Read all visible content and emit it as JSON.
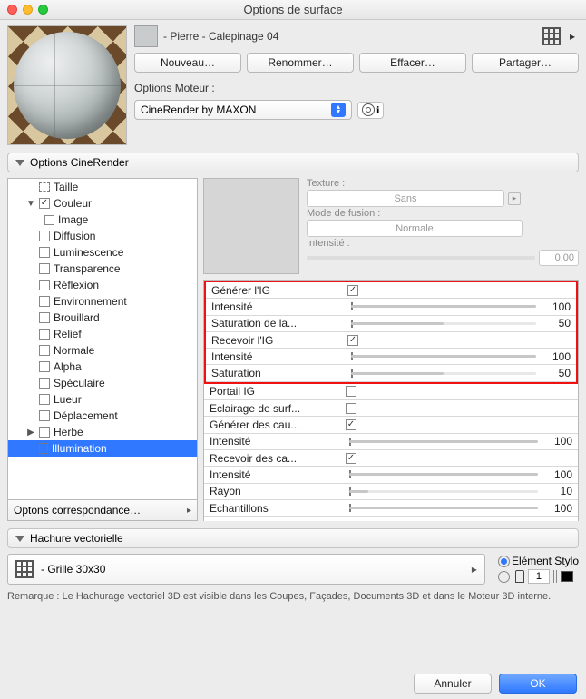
{
  "window": {
    "title": "Options de surface"
  },
  "material": {
    "name": "- Pierre - Calepinage 04"
  },
  "buttons": {
    "new": "Nouveau…",
    "rename": "Renommer…",
    "delete": "Effacer…",
    "share": "Partager…"
  },
  "engine": {
    "label": "Options Moteur :",
    "value": "CineRender by MAXON"
  },
  "cine_section": {
    "title": "Options CineRender"
  },
  "tree": {
    "items": [
      {
        "label": "Taille",
        "type": "size"
      },
      {
        "label": "Couleur",
        "type": "cb",
        "checked": true,
        "expand": true
      },
      {
        "label": "Image",
        "type": "img",
        "indent": 2
      },
      {
        "label": "Diffusion",
        "type": "cb"
      },
      {
        "label": "Luminescence",
        "type": "cb"
      },
      {
        "label": "Transparence",
        "type": "cb"
      },
      {
        "label": "Réflexion",
        "type": "cb"
      },
      {
        "label": "Environnement",
        "type": "cb"
      },
      {
        "label": "Brouillard",
        "type": "cb"
      },
      {
        "label": "Relief",
        "type": "cb"
      },
      {
        "label": "Normale",
        "type": "cb"
      },
      {
        "label": "Alpha",
        "type": "cb"
      },
      {
        "label": "Spéculaire",
        "type": "cb"
      },
      {
        "label": "Lueur",
        "type": "cb"
      },
      {
        "label": "Déplacement",
        "type": "cb"
      },
      {
        "label": "Herbe",
        "type": "cb",
        "expander": true
      },
      {
        "label": "Illumination",
        "type": "file",
        "selected": true
      }
    ],
    "footer": "Optons correspondance…"
  },
  "texture": {
    "label_tex": "Texture :",
    "btn_tex": "Sans",
    "label_mode": "Mode de fusion :",
    "btn_mode": "Normale",
    "label_int": "Intensité :",
    "val_int": "0,00"
  },
  "props": {
    "group_red": [
      {
        "name": "Générer l'IG",
        "type": "check",
        "checked": true
      },
      {
        "name": "Intensité",
        "type": "slider",
        "value": 100
      },
      {
        "name": "Saturation de la...",
        "type": "slider",
        "value": 50
      },
      {
        "name": "Recevoir l'IG",
        "type": "check",
        "checked": true
      },
      {
        "name": "Intensité",
        "type": "slider",
        "value": 100
      },
      {
        "name": "Saturation",
        "type": "slider",
        "value": 50
      }
    ],
    "rest": [
      {
        "name": "Portail IG",
        "type": "check",
        "checked": false
      },
      {
        "name": "Eclairage de surf...",
        "type": "check",
        "checked": false
      },
      {
        "name": "Générer des cau...",
        "type": "check",
        "checked": true
      },
      {
        "name": "Intensité",
        "type": "slider",
        "value": 100
      },
      {
        "name": "Recevoir des ca...",
        "type": "check",
        "checked": true
      },
      {
        "name": "Intensité",
        "type": "slider",
        "value": 100
      },
      {
        "name": "Rayon",
        "type": "slider",
        "value": 10
      },
      {
        "name": "Echantillons",
        "type": "slider",
        "value": 100
      }
    ]
  },
  "hach": {
    "title": "Hachure vectorielle",
    "selector": "- Grille 30x30",
    "radio1": "Elément Stylo",
    "num": "1"
  },
  "remark": "Remarque : Le Hachurage vectoriel 3D est visible dans les Coupes, Façades, Documents 3D et dans le Moteur 3D interne.",
  "footer": {
    "cancel": "Annuler",
    "ok": "OK"
  }
}
